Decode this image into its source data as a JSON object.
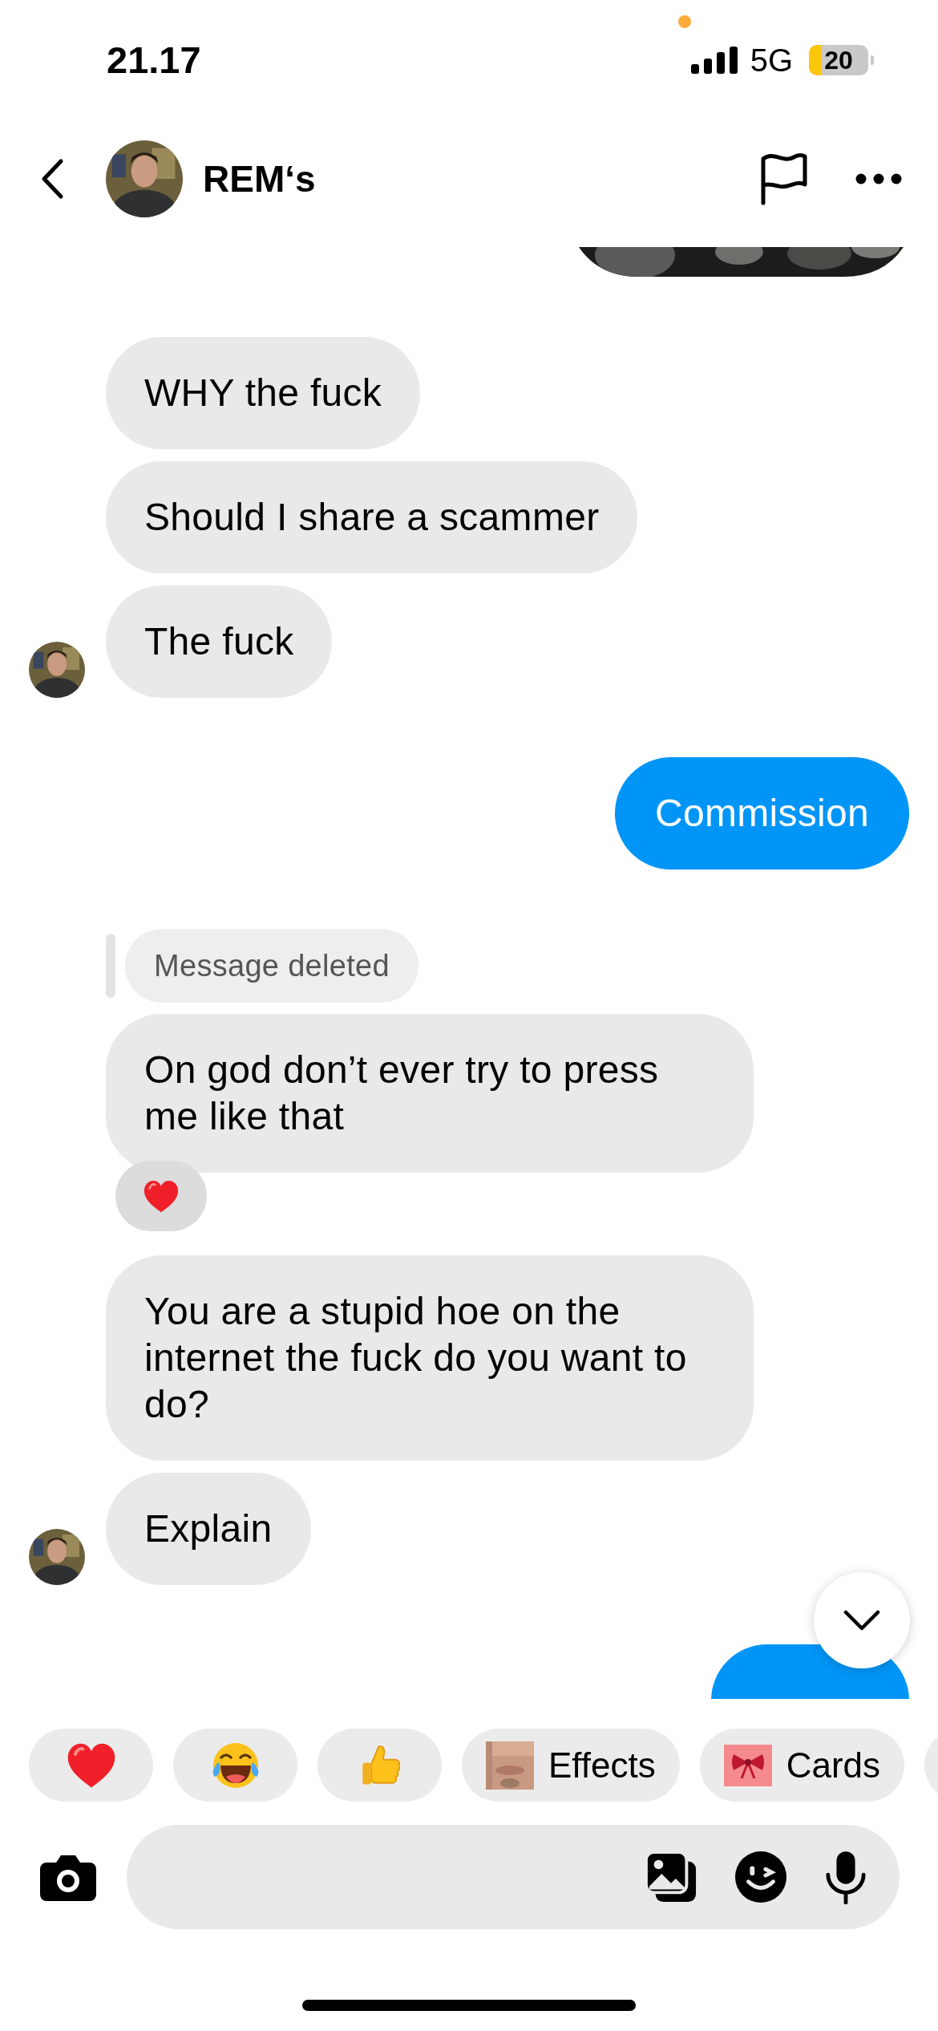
{
  "status_bar": {
    "time": "21.17",
    "network": "5G",
    "battery": "20"
  },
  "header": {
    "title": "REM‘s"
  },
  "messages": [
    {
      "kind": "picture",
      "outgoing": true
    },
    {
      "kind": "text",
      "outgoing": false,
      "text": "WHY the fuck",
      "avatar": false
    },
    {
      "kind": "text",
      "outgoing": false,
      "text": "Should I share a scammer",
      "avatar": false
    },
    {
      "kind": "text",
      "outgoing": false,
      "text": "The fuck",
      "avatar": true
    },
    {
      "kind": "text",
      "outgoing": true,
      "text": "Commission"
    },
    {
      "kind": "reply",
      "outgoing": false,
      "text": "Message deleted"
    },
    {
      "kind": "text",
      "outgoing": false,
      "text": "On god don’t ever try to press me like that",
      "avatar": false,
      "reacted": true
    },
    {
      "kind": "text",
      "outgoing": false,
      "text": "You are a stupid hoe on the internet the fuck do you want to do?",
      "avatar": false
    },
    {
      "kind": "text",
      "outgoing": false,
      "text": "Explain",
      "avatar": true
    },
    {
      "kind": "text",
      "outgoing": true
    }
  ],
  "quick_replies": [
    {
      "kind": "heart"
    },
    {
      "kind": "laugh"
    },
    {
      "kind": "thumbs_up"
    },
    {
      "kind": "effects",
      "label": "Effects"
    },
    {
      "kind": "cards",
      "label": "Cards"
    },
    {
      "kind": "more"
    }
  ]
}
